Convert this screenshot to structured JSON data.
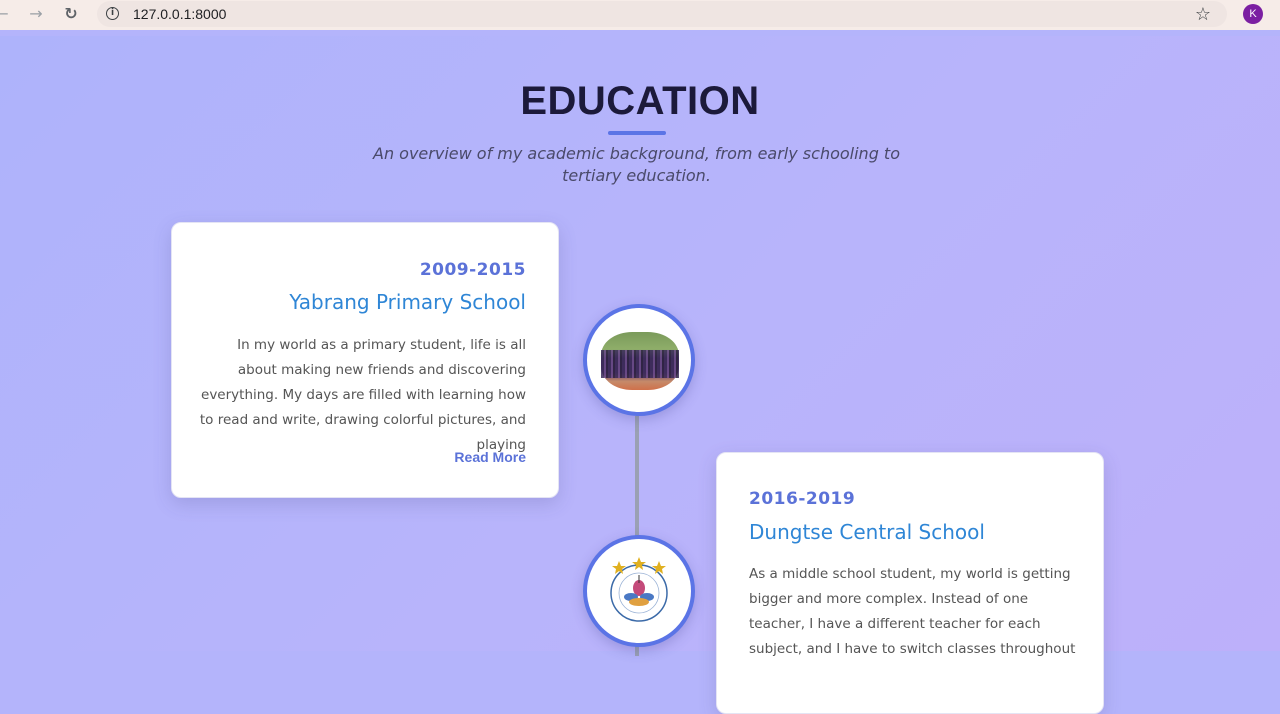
{
  "browser": {
    "url": "127.0.0.1:8000",
    "avatar_letter": "K",
    "back_icon": "arrow-left-icon",
    "forward_icon": "arrow-right-icon",
    "reload_icon": "reload-icon",
    "bookmark_icon": "star-icon"
  },
  "section": {
    "title": "EDUCATION",
    "subtitle": "An overview of my academic background, from early schooling to tertiary education.",
    "accent_color": "#5b74e6"
  },
  "timeline": [
    {
      "years": "2009-2015",
      "school": "Yabrang Primary School",
      "description": "In my world as a primary student, life is all about making new friends and discovering everything. My days are filled with learning how to read and write, drawing colorful pictures, and playing",
      "read_more": "Read More",
      "image": "school-assembly-photo"
    },
    {
      "years": "2016-2019",
      "school": "Dungtse Central School",
      "description": "As a middle school student, my world is getting bigger and more complex. Instead of one teacher, I have a different teacher for each subject, and I have to switch classes throughout",
      "image": "school-logo"
    }
  ]
}
